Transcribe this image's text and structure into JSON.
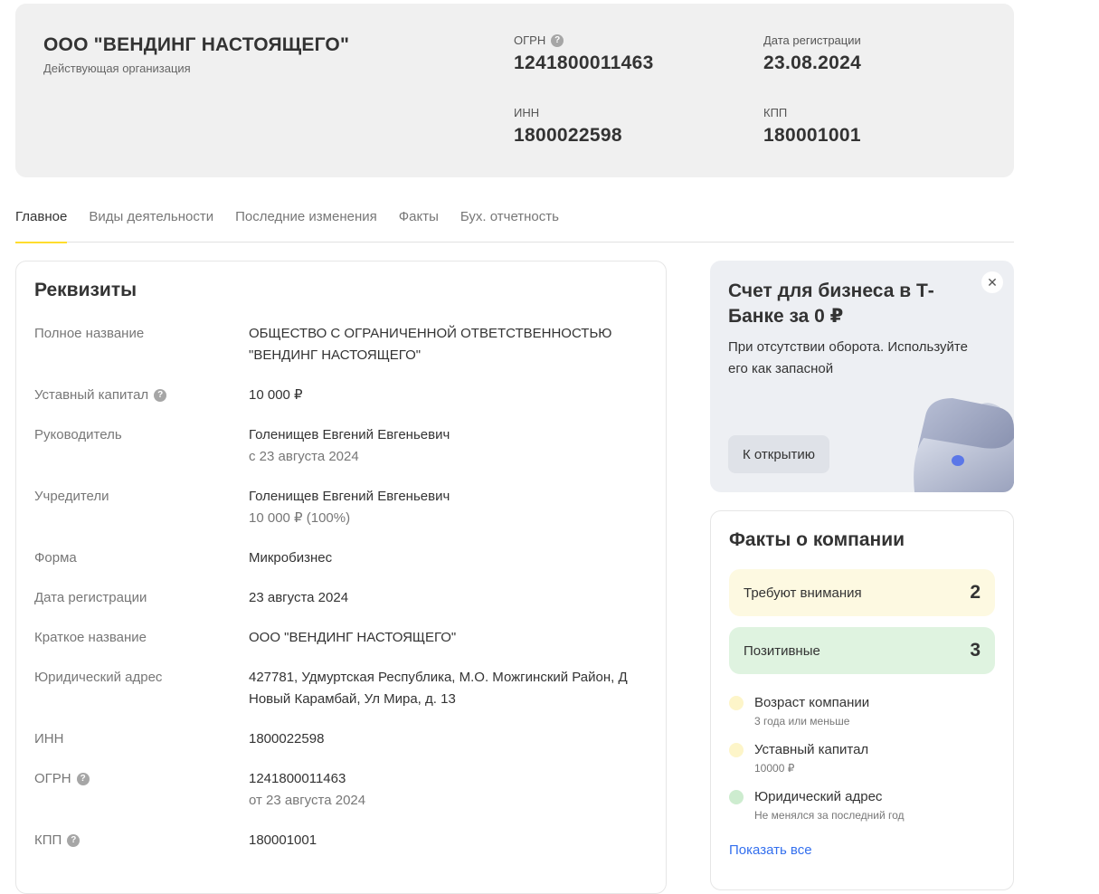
{
  "header": {
    "company_name": "ООО \"ВЕНДИНГ НАСТОЯЩЕГО\"",
    "status": "Действующая организация",
    "fields": {
      "ogrn": {
        "label": "ОГРН",
        "value": "1241800011463"
      },
      "reg_date": {
        "label": "Дата регистрации",
        "value": "23.08.2024"
      },
      "inn": {
        "label": "ИНН",
        "value": "1800022598"
      },
      "kpp": {
        "label": "КПП",
        "value": "180001001"
      }
    }
  },
  "tabs": [
    {
      "label": "Главное",
      "active": true
    },
    {
      "label": "Виды деятельности",
      "active": false
    },
    {
      "label": "Последние изменения",
      "active": false
    },
    {
      "label": "Факты",
      "active": false
    },
    {
      "label": "Бух. отчетность",
      "active": false
    }
  ],
  "requisites": {
    "title": "Реквизиты",
    "rows": [
      {
        "label": "Полное название",
        "value": "ОБЩЕСТВО С ОГРАНИЧЕННОЙ ОТВЕТСТВЕННОСТЬЮ \"ВЕНДИНГ НАСТОЯЩЕГО\"",
        "sub": ""
      },
      {
        "label": "Уставный капитал",
        "value": "10 000 ₽",
        "sub": ""
      },
      {
        "label": "Руководитель",
        "value": "Голенищев Евгений Евгеньевич",
        "sub": "с 23 августа 2024"
      },
      {
        "label": "Учредители",
        "value": "Голенищев Евгений Евгеньевич",
        "sub": "10 000 ₽ (100%)"
      },
      {
        "label": "Форма",
        "value": "Микробизнес",
        "sub": ""
      },
      {
        "label": "Дата регистрации",
        "value": "23 августа 2024",
        "sub": ""
      },
      {
        "label": "Краткое название",
        "value": "ООО \"ВЕНДИНГ НАСТОЯЩЕГО\"",
        "sub": ""
      },
      {
        "label": "Юридический адрес",
        "value": "427781, Удмуртская Республика, М.О. Можгинский Район, Д Новый Карамбай, Ул Мира, д. 13",
        "sub": ""
      },
      {
        "label": "ИНН",
        "value": "1800022598",
        "sub": ""
      },
      {
        "label": "ОГРН",
        "value": "1241800011463",
        "sub": "от 23 августа 2024"
      },
      {
        "label": "КПП",
        "value": "180001001",
        "sub": ""
      }
    ]
  },
  "promo": {
    "title": "Счет для бизнеса в Т-Банке за 0 ₽",
    "text": "При отсутствии оборота. Используйте его как запасной",
    "button": "К открытию",
    "close": "✕"
  },
  "facts": {
    "title": "Факты о компании",
    "attention": {
      "label": "Требуют внимания",
      "count": "2"
    },
    "positive": {
      "label": "Позитивные",
      "count": "3"
    },
    "items": [
      {
        "name": "Возраст компании",
        "desc": "3 года или меньше",
        "color": "#fdf5c9"
      },
      {
        "name": "Уставный капитал",
        "desc": "10000 ₽",
        "color": "#fdf5c9"
      },
      {
        "name": "Юридический адрес",
        "desc": "Не менялся за последний год",
        "color": "#cdeccf"
      }
    ],
    "show_all": "Показать все"
  },
  "colors": {
    "accent": "#ffdd2d",
    "link": "#336fee",
    "header_bg": "#f0f0f0"
  }
}
